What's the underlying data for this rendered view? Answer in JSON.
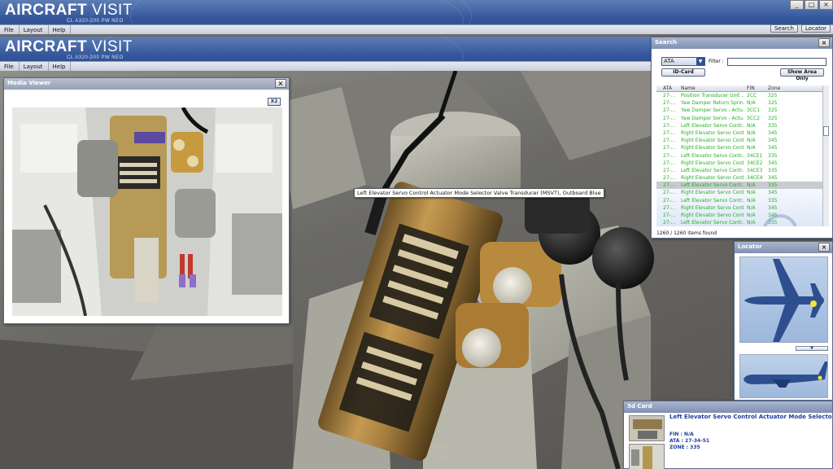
{
  "app": {
    "brand_bold": "AIRCRAFT",
    "brand_light": "VISIT",
    "subtitle": "CL A320-200 PW NEO",
    "menu": [
      "File",
      "Layout",
      "Help"
    ],
    "window_buttons": [
      "_",
      "□",
      "×"
    ],
    "top_actions": [
      "Search",
      "Locator"
    ]
  },
  "media_viewer": {
    "title": "Media Viewer",
    "close": "×",
    "zoom_button": "X2"
  },
  "tooltip": "Left Elevator Servo Control Actuator Mode Selector Valve Transducer (MSVT), Outboard Blue",
  "search": {
    "title": "Search",
    "close": "×",
    "category": "ATA",
    "filter_label": "Filter :",
    "filter_value": "",
    "id_card_button": "ID-Card",
    "show_area_button": "Show Area Only",
    "columns": [
      "ATA",
      "Name",
      "FIN",
      "Zone"
    ],
    "rows": [
      {
        "ata": "27-...",
        "name": "Position Transducer Unit ...",
        "fin": "2CC",
        "zone": "325"
      },
      {
        "ata": "27-...",
        "name": "Yaw Damper Return Sprin...",
        "fin": "N/A",
        "zone": "325"
      },
      {
        "ata": "27-...",
        "name": "Yaw Damper Servo - Actu...",
        "fin": "3CC1",
        "zone": "325"
      },
      {
        "ata": "27-...",
        "name": "Yaw Damper Servo - Actu...",
        "fin": "3CC2",
        "zone": "325"
      },
      {
        "ata": "27-...",
        "name": "Left Elevator Servo Contr...",
        "fin": "N/A",
        "zone": "335"
      },
      {
        "ata": "27-...",
        "name": "Right Elevator Servo Cont...",
        "fin": "N/A",
        "zone": "345"
      },
      {
        "ata": "27-...",
        "name": "Right Elevator Servo Cont...",
        "fin": "N/A",
        "zone": "345"
      },
      {
        "ata": "27-...",
        "name": "Right Elevator Servo Cont...",
        "fin": "N/A",
        "zone": "345"
      },
      {
        "ata": "27-...",
        "name": "Left Elevator Servo Contr...",
        "fin": "34CE1",
        "zone": "335"
      },
      {
        "ata": "27-...",
        "name": "Right Elevator Servo Cont...",
        "fin": "34CE2",
        "zone": "345"
      },
      {
        "ata": "27-...",
        "name": "Left Elevator Servo Contr...",
        "fin": "34CE3",
        "zone": "335"
      },
      {
        "ata": "27-...",
        "name": "Right Elevator Servo Cont...",
        "fin": "34CE4",
        "zone": "345"
      },
      {
        "ata": "27-...",
        "name": "Left Elevator Servo Contr...",
        "fin": "N/A",
        "zone": "335"
      },
      {
        "ata": "27-...",
        "name": "Right Elevator Servo Cont...",
        "fin": "N/A",
        "zone": "345"
      },
      {
        "ata": "27-...",
        "name": "Left Elevator Servo Contr...",
        "fin": "N/A",
        "zone": "335"
      },
      {
        "ata": "27-...",
        "name": "Right Elevator Servo Cont...",
        "fin": "N/A",
        "zone": "345"
      },
      {
        "ata": "27-...",
        "name": "Right Elevator Servo Cont...",
        "fin": "N/A",
        "zone": "345"
      },
      {
        "ata": "27-...",
        "name": "Left Elevator Servo Contr...",
        "fin": "N/A",
        "zone": "335"
      }
    ],
    "selected_row": 12,
    "count": "1260 / 1260 items found"
  },
  "locator": {
    "title": "Locator",
    "close": "×",
    "separator_arrow": "▼"
  },
  "id_card": {
    "title": "3d Card",
    "item_title": "Left Elevator Servo Control Actuator Mode Selector Valve Transducer (MSVT), Outboard Blue",
    "fin": "FIN : N/A",
    "ata": "ATA : 27-34-51",
    "zone": "ZONE : 335"
  },
  "colors": {
    "header": "#34569a",
    "list_text": "#22b022",
    "card_text": "#1f3c9a"
  }
}
